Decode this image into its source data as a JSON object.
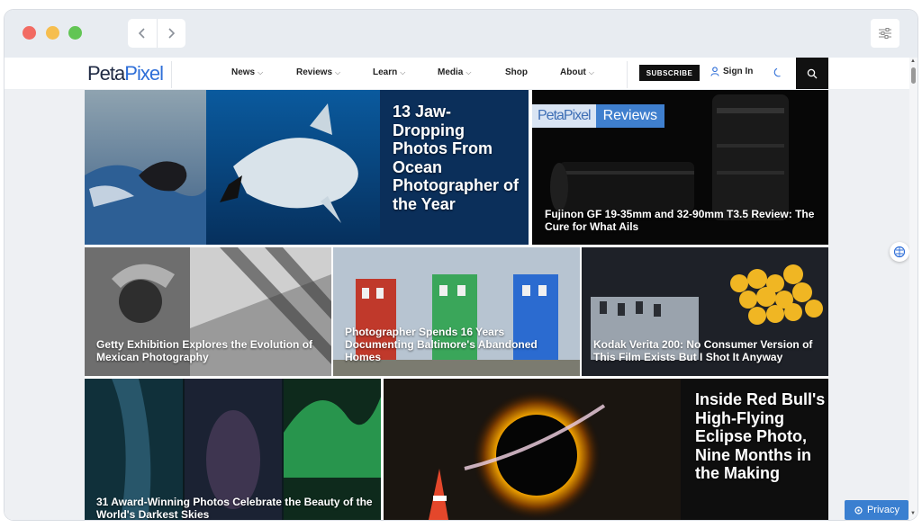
{
  "browser": {
    "back_icon": "chevron-left-icon",
    "forward_icon": "chevron-right-icon",
    "settings_icon": "sliders-icon"
  },
  "site": {
    "logo_part1": "Peta",
    "logo_part2": "Pixel",
    "nav": [
      {
        "label": "News",
        "has_dropdown": true
      },
      {
        "label": "Reviews",
        "has_dropdown": true
      },
      {
        "label": "Learn",
        "has_dropdown": true
      },
      {
        "label": "Media",
        "has_dropdown": true
      },
      {
        "label": "Shop",
        "has_dropdown": false
      },
      {
        "label": "About",
        "has_dropdown": true
      }
    ],
    "subscribe_label": "SUBSCRIBE",
    "signin_label": "Sign In",
    "caret": "⌵"
  },
  "articles": [
    {
      "title": "13 Jaw-Dropping Photos From Ocean Photographer of the Year"
    },
    {
      "title": "Fujinon GF 19-35mm and 32-90mm T3.5 Review: The Cure for What Ails",
      "badge_left": "PetaPixel",
      "badge_right": "Reviews"
    },
    {
      "title": "Getty Exhibition Explores the Evolution of Mexican Photography"
    },
    {
      "title": "Photographer Spends 16 Years Documenting Baltimore's Abandoned Homes"
    },
    {
      "title": "Kodak Verita 200: No Consumer Version of This Film Exists But I Shot It Anyway"
    },
    {
      "title": "31 Award-Winning Photos Celebrate the Beauty of the World's Darkest Skies"
    },
    {
      "title": "Inside Red Bull's High-Flying Eclipse Photo, Nine Months in the Making"
    }
  ],
  "privacy_label": "Privacy",
  "colors": {
    "brand_blue": "#2f6fd8",
    "privacy_blue": "#3a7fd0",
    "dark": "#111111"
  }
}
